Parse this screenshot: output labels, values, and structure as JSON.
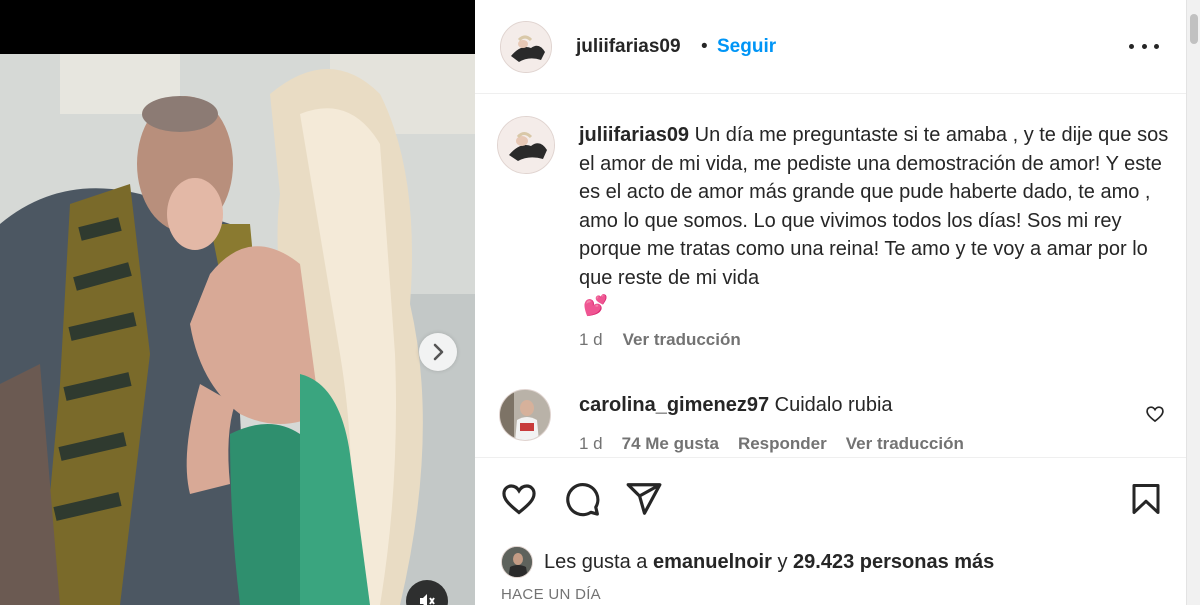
{
  "post": {
    "username": "juliifarias09",
    "separator": "•",
    "follow_label": "Seguir",
    "caption_text": "Un día me preguntaste si te amaba , y te dije que sos el amor de mi vida, me pediste una demostración de amor! Y este es el acto de amor más grande que pude haberte dado, te amo , amo lo que somos. Lo que vivimos todos los días! Sos mi rey porque me tratas como una reina! Te amo y te voy a amar por lo que reste de mi vida",
    "caption_emoji": "💕",
    "caption_age": "1 d",
    "translate_label": "Ver traducción"
  },
  "comment": {
    "username": "carolina_gimenez97",
    "text": "Cuidalo rubia",
    "age": "1 d",
    "likes": "74 Me gusta",
    "reply_label": "Responder",
    "translate_label": "Ver traducción"
  },
  "likes": {
    "prefix": "Les gusta a",
    "user": "emanuelnoir",
    "connector": "y",
    "others": "29.423 personas más"
  },
  "timestamp": "HACE UN DÍA",
  "colors": {
    "accent": "#0095f6",
    "text": "#262626",
    "muted": "#737373",
    "emoji_heart": "#e8457d"
  },
  "icons": [
    "carousel-next-icon",
    "mute-icon",
    "more-options-icon",
    "heart-icon",
    "comment-icon",
    "share-icon",
    "bookmark-icon"
  ]
}
